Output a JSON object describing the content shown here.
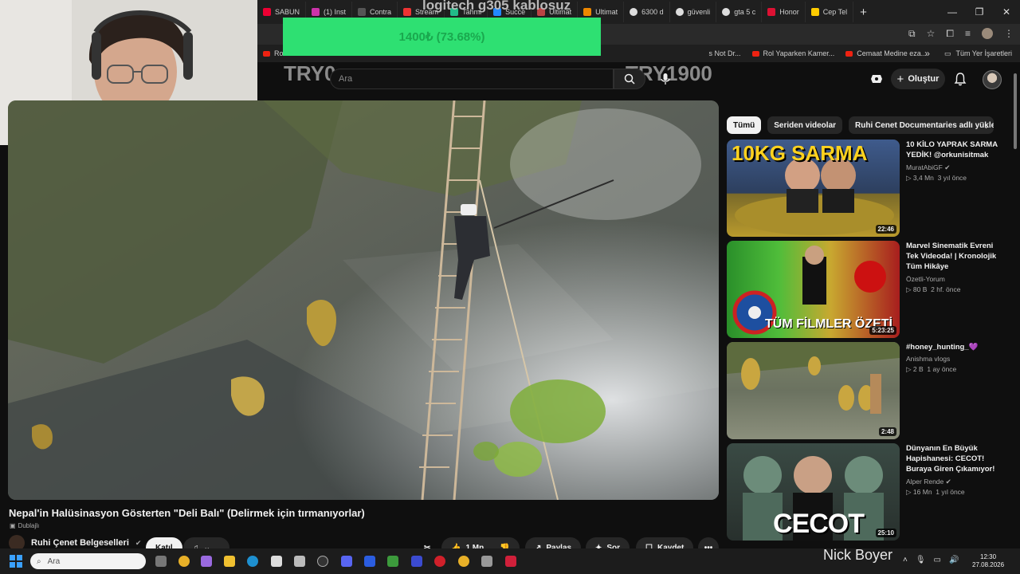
{
  "overlay": {
    "title": "logitech g305 kablosuz",
    "progress_text": "1400₺ (73.68%)",
    "progress_fraction": 0.7368,
    "try_left": "TRY0",
    "try_right": "TRY1900"
  },
  "browser": {
    "tabs": [
      {
        "label": "SABUN",
        "color": "#e03",
        "icon": "youtube-icon"
      },
      {
        "label": "(1) Inst",
        "color": "#c3a",
        "icon": "instagram-icon"
      },
      {
        "label": "Contra",
        "color": "#555",
        "icon": "tab-icon"
      },
      {
        "label": "Stream",
        "color": "#e33",
        "icon": "stream-icon"
      },
      {
        "label": "Tahmi",
        "color": "#2b8",
        "icon": "tab-icon"
      },
      {
        "label": "Succe",
        "color": "#28f",
        "icon": "tab-icon"
      },
      {
        "label": "Ultimat",
        "color": "#b44",
        "icon": "tab-icon"
      },
      {
        "label": "Ultimat",
        "color": "#e80",
        "icon": "tab-icon"
      },
      {
        "label": "6300 d",
        "color": "#ddd",
        "icon": "google-icon"
      },
      {
        "label": "güvenli",
        "color": "#ddd",
        "icon": "google-icon"
      },
      {
        "label": "gta 5 c",
        "color": "#ddd",
        "icon": "google-icon"
      },
      {
        "label": "Honor",
        "color": "#d13",
        "icon": "tab-icon"
      },
      {
        "label": "Cep Tel",
        "color": "#fc0",
        "icon": "store-icon"
      }
    ],
    "bookmarks": [
      {
        "label": "Ro"
      },
      {
        "label": "s Not Dr..."
      },
      {
        "label": "Rol Yaparken Kamer..."
      },
      {
        "label": "Cemaat Medine eza..."
      }
    ],
    "bookmarks_more": "»",
    "all_bookmarks": "Tüm Yer İşaretleri"
  },
  "youtube": {
    "search_placeholder": "Ara",
    "create_label": "Oluştur",
    "video_title": "Nepal'in Halüsinasyon Gösterten \"Deli Balı\" (Delirmek için tırmanıyorlar)",
    "dub_label": "Dublajlı",
    "channel_name": "Ruhi Çenet Belgeselleri",
    "join_label": "Katıl",
    "likes": "1 Mn",
    "share_label": "Paylaş",
    "ask_label": "Sor",
    "save_label": "Kaydet",
    "more_label": "•••",
    "chips": [
      "Tümü",
      "Seriden videolar",
      "Ruhi Cenet Documentaries adlı yükleyic"
    ],
    "recommendations": [
      {
        "title": "10 KİLO YAPRAK SARMA YEDİK! @orkunisitmak",
        "channel": "MuratAbiGF",
        "verified": true,
        "views": "3,4 Mn",
        "age": "3 yıl önce",
        "duration": "22:46",
        "thumb_text": "10KG  SARMA"
      },
      {
        "title": "Marvel Sinematik Evreni Tek Videoda! | Kronolojik Tüm Hikâye",
        "channel": "Özetli-Yorum",
        "verified": false,
        "views": "80 B",
        "age": "2 hf. önce",
        "duration": "5:23:25",
        "thumb_text": "TÜM FİLMLER ÖZETİ"
      },
      {
        "title": "#honey_hunting_💜",
        "channel": "Anishma vlogs",
        "verified": false,
        "views": "2 B",
        "age": "1 ay önce",
        "duration": "2:48",
        "thumb_text": ""
      },
      {
        "title": "Dünyanın En Büyük Hapishanesi: CECOT! Buraya Giren Çıkamıyor!",
        "channel": "Alper Rende",
        "verified": true,
        "views": "16 Mn",
        "age": "1 yıl önce",
        "duration": "25:10",
        "thumb_text": "CECOT"
      }
    ]
  },
  "taskbar": {
    "search_placeholder": "Ara",
    "streamer_name": "Nick Boyer",
    "time": "12:30",
    "date": "27.08.2026"
  }
}
